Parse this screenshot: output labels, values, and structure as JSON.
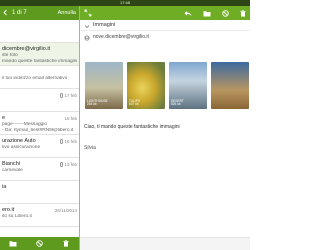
{
  "status_bar": {
    "time": "17:48"
  },
  "left": {
    "counter": "1 di 7",
    "cancel_label": "Annulla",
    "mails": [
      {
        "line1": "",
        "line2": "",
        "line3": "",
        "date": ""
      },
      {
        "line1": "dicembre@virgilio.it",
        "line2": "ste foto",
        "line3": "mando queste fantastiche immagini",
        "date": ""
      },
      {
        "line1": "",
        "line2": "",
        "line3": "il tuo indirizzo email alternativo",
        "date": ""
      },
      {
        "line1": "",
        "line2": "",
        "line3": "",
        "date": ""
      },
      {
        "line1": "",
        "line2": "",
        "line3": "",
        "date": "17 feb"
      },
      {
        "line1": "e",
        "line2": "",
        "line3": "",
        "date": "16 feb"
      },
      {
        "line1": "",
        "line2": "page-------Messaggio",
        "line3": "- Da: rtymail_6est#RN9l@libero.it",
        "date": ""
      },
      {
        "line1": "urazione Auto",
        "line2": "tivo assicurazione",
        "line3": "",
        "date": "16 feb"
      },
      {
        "line1": "",
        "line2": "",
        "line3": "",
        "date": ""
      },
      {
        "line1": "Bianchi",
        "line2": "carnevale",
        "line3": "",
        "date": "13 feb"
      },
      {
        "line1": "ia",
        "line2": "",
        "line3": "",
        "date": ""
      },
      {
        "line1": "",
        "line2": "",
        "line3": "",
        "date": ""
      },
      {
        "line1": "ero.it",
        "line2": "ito su Libero.it",
        "line3": "",
        "date": "26/11/2014"
      }
    ]
  },
  "right": {
    "subject": "Immagini",
    "from": "nove.dicembre@virgilio.it",
    "thumbnails": [
      {
        "caption1": "LIGHTHOUSE",
        "caption2": "244 kb"
      },
      {
        "caption1": "TULIPS",
        "caption2": "607 kb"
      },
      {
        "caption1": "DESERT",
        "caption2": "826 kb"
      },
      {
        "caption1": "",
        "caption2": ""
      }
    ],
    "body": "Ciao, ti mando queste fantastiche immagini",
    "signature": "Silvia"
  },
  "colors": {
    "left_bar": "#5d9a1e",
    "right_bar": "#6fae24",
    "status_bar": "#2d4516"
  },
  "icons": {
    "left_toolbar": [
      "folder-icon",
      "block-icon",
      "trash-icon"
    ],
    "right_bar": [
      "expand-icon",
      "reply-icon",
      "folder-icon",
      "block-icon",
      "trash-icon"
    ]
  }
}
